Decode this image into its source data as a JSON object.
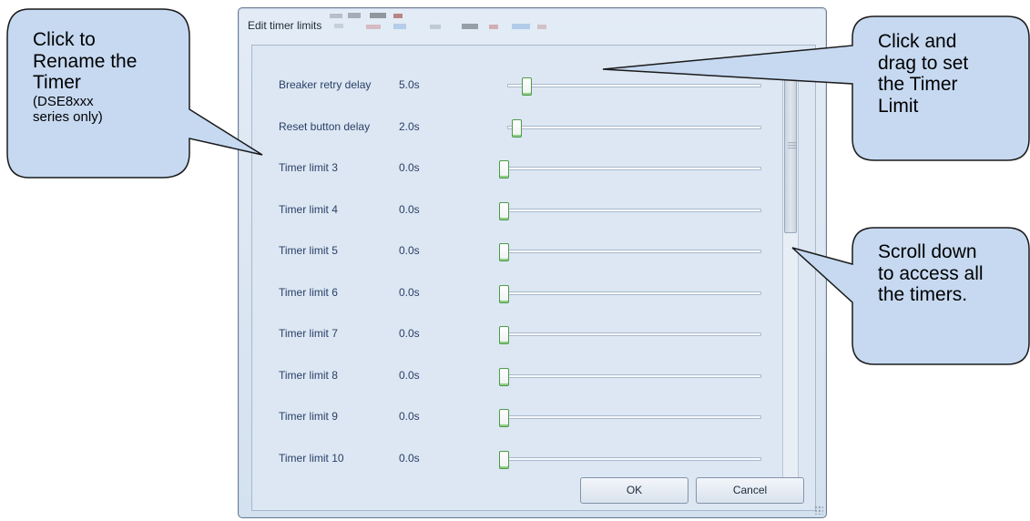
{
  "dialog": {
    "title": "Edit timer limits",
    "ok_label": "OK",
    "cancel_label": "Cancel"
  },
  "timers": [
    {
      "label": "Breaker retry delay",
      "value": "5.0s",
      "fraction": 0.06
    },
    {
      "label": "Reset button delay",
      "value": "2.0s",
      "fraction": 0.02
    },
    {
      "label": "Timer limit 3",
      "value": "0.0s",
      "fraction": 0.0
    },
    {
      "label": "Timer limit 4",
      "value": "0.0s",
      "fraction": 0.0
    },
    {
      "label": "Timer limit 5",
      "value": "0.0s",
      "fraction": 0.0
    },
    {
      "label": "Timer limit 6",
      "value": "0.0s",
      "fraction": 0.0
    },
    {
      "label": "Timer limit 7",
      "value": "0.0s",
      "fraction": 0.0
    },
    {
      "label": "Timer limit 8",
      "value": "0.0s",
      "fraction": 0.0
    },
    {
      "label": "Timer limit 9",
      "value": "0.0s",
      "fraction": 0.0
    },
    {
      "label": "Timer limit 10",
      "value": "0.0s",
      "fraction": 0.0
    }
  ],
  "callouts": {
    "rename_line1": "Click to",
    "rename_line2": "Rename the",
    "rename_line3": "Timer",
    "rename_note1": "(DSE8xxx",
    "rename_note2": "series only)",
    "drag_line1": "Click and",
    "drag_line2": "drag to set",
    "drag_line3": "the Timer",
    "drag_line4": "Limit",
    "scroll_line1": "Scroll down",
    "scroll_line2": "to access all",
    "scroll_line3": "the timers."
  },
  "colors": {
    "callout_fill": "#c6d9f1",
    "slider_thumb_border": "#4f9a4a",
    "label_text": "#2a3f66"
  },
  "scrollbar": {
    "visible_fraction": 0.4
  }
}
